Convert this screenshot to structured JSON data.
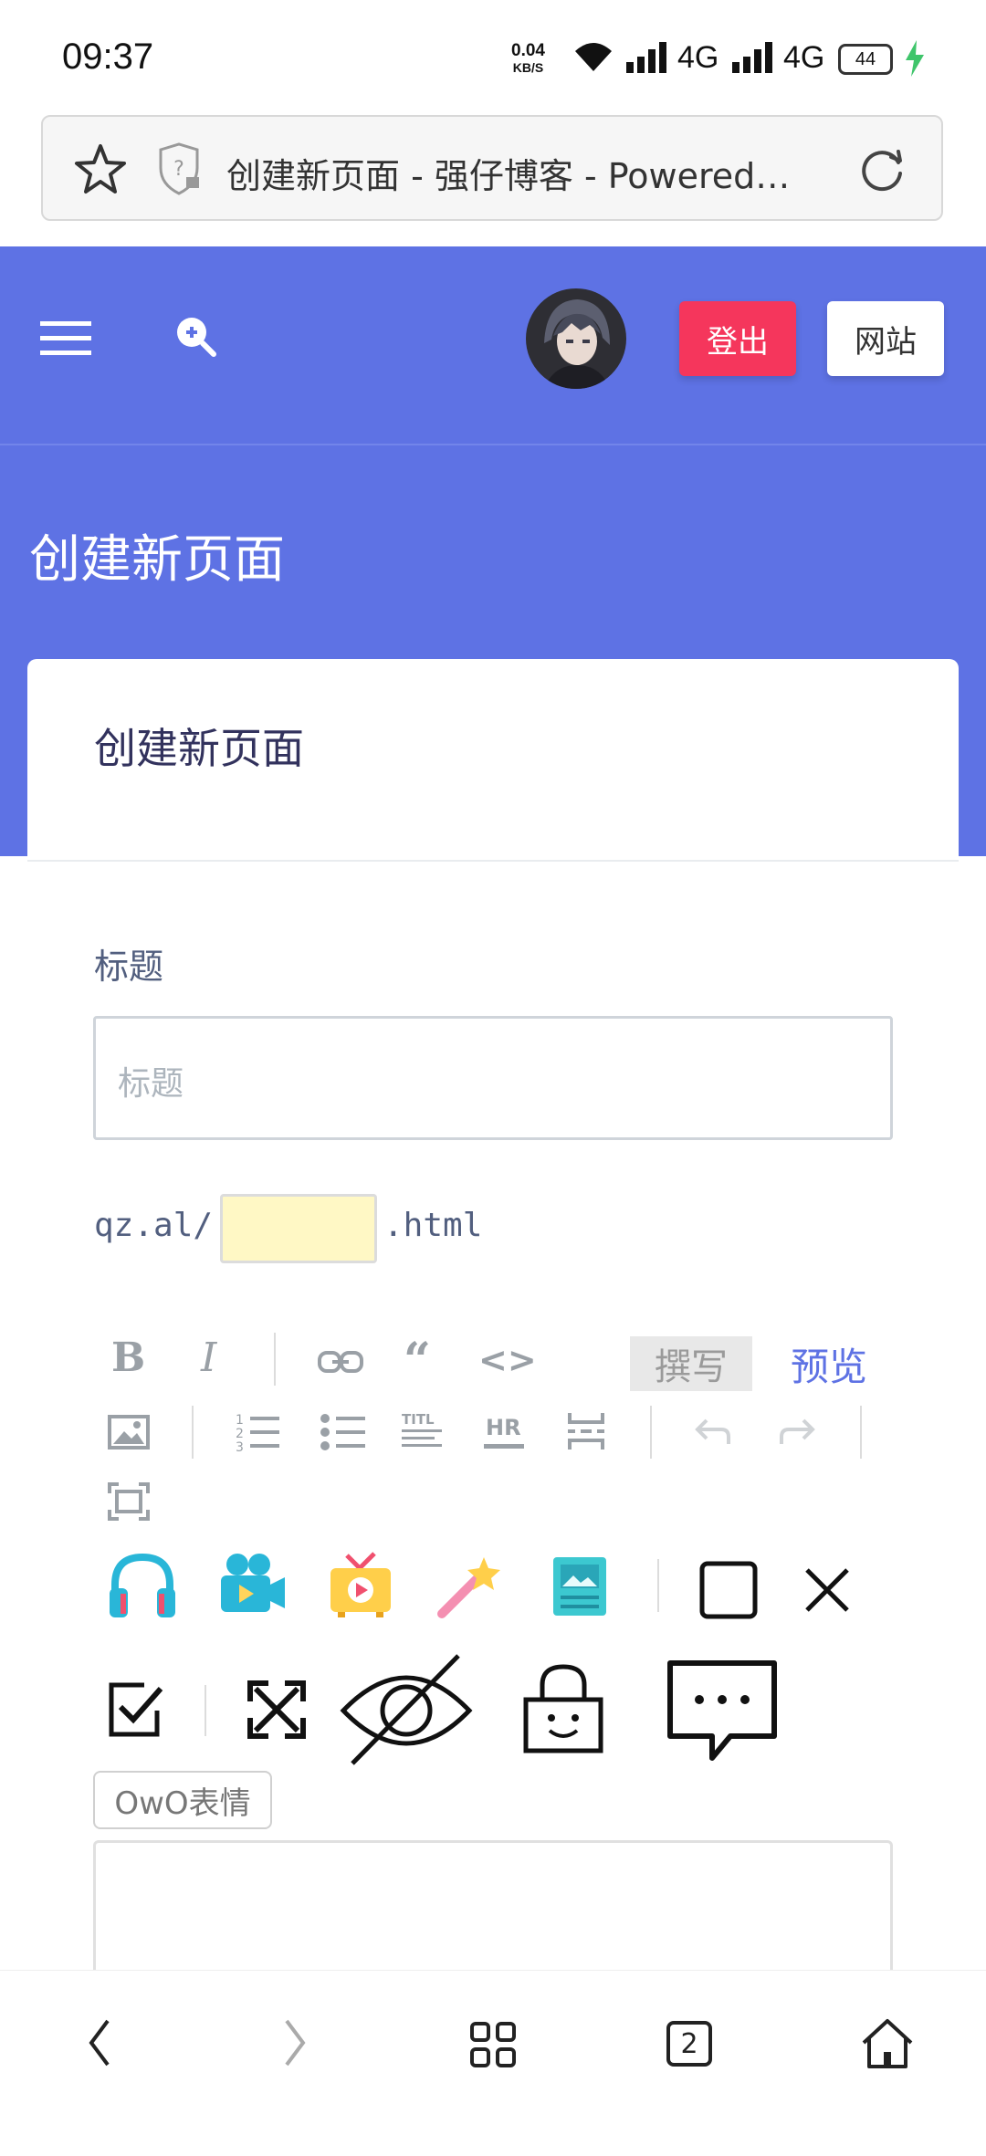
{
  "status_bar": {
    "time": "09:37",
    "speed_value": "0.04",
    "speed_unit": "KB/S",
    "network_1": "4G",
    "network_2": "4G",
    "battery": "44"
  },
  "browser": {
    "url_title": "创建新页面 - 强仔博客 - Powered…"
  },
  "header": {
    "logout_label": "登出",
    "site_label": "网站"
  },
  "hero": {
    "title": "创建新页面"
  },
  "card": {
    "title": "创建新页面",
    "field_label": "标题",
    "title_placeholder": "标题",
    "slug_prefix": "qz.al/",
    "slug_suffix": ".html"
  },
  "editor": {
    "write_tab": "撰写",
    "preview_tab": "预览",
    "owo_label": "OwO表情"
  },
  "bottom_nav": {
    "tabs_count": "2"
  },
  "colors": {
    "primary": "#5e72e4",
    "danger": "#f5365c"
  }
}
